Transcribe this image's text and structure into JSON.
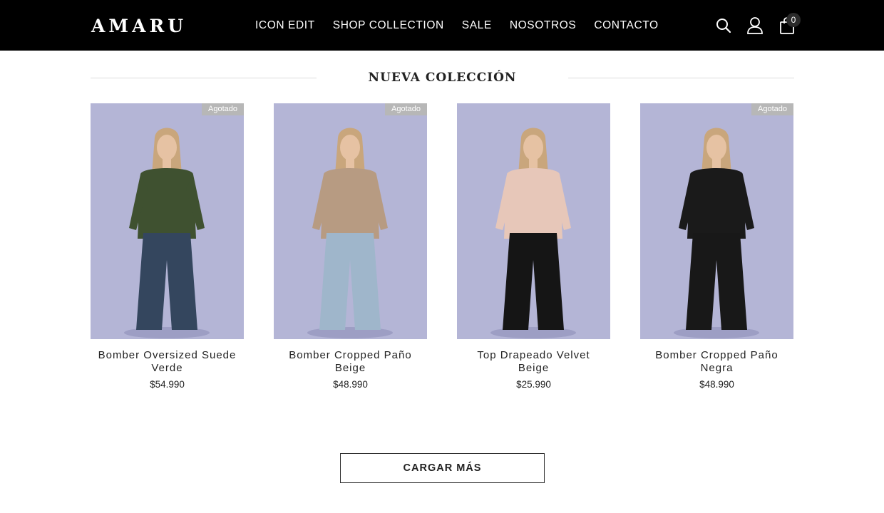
{
  "brand": {
    "name": "AMARU"
  },
  "nav": [
    {
      "label": "ICON EDIT"
    },
    {
      "label": "SHOP COLLECTION"
    },
    {
      "label": "SALE"
    },
    {
      "label": "NOSOTROS"
    },
    {
      "label": "CONTACTO"
    }
  ],
  "header_icons": [
    "search-icon",
    "user-icon",
    "shopping-bag-icon"
  ],
  "cart": {
    "count": "0"
  },
  "section": {
    "title": "NUEVA COLECCIÓN"
  },
  "products": [
    {
      "name": "Bomber Oversized Suede Verde",
      "price": "$54.990",
      "badge": "Agotado",
      "top_color": "#3f5130",
      "bottom_color": "#34465e"
    },
    {
      "name": "Bomber Cropped Paño Beige",
      "price": "$48.990",
      "badge": "Agotado",
      "top_color": "#b79b82",
      "bottom_color": "#9fb6cb"
    },
    {
      "name": "Top Drapeado Velvet Beige",
      "price": "$25.990",
      "badge": "",
      "top_color": "#e7c7b9",
      "bottom_color": "#151515"
    },
    {
      "name": "Bomber Cropped Paño Negra",
      "price": "$48.990",
      "badge": "Agotado",
      "top_color": "#1a1a1a",
      "bottom_color": "#181818"
    }
  ],
  "load_more": {
    "label": "CARGAR MÁS"
  },
  "colors": {
    "header_bg": "#000000",
    "photo_bg": "#b4b5d6",
    "badge_bg": "#b7b7b7"
  }
}
